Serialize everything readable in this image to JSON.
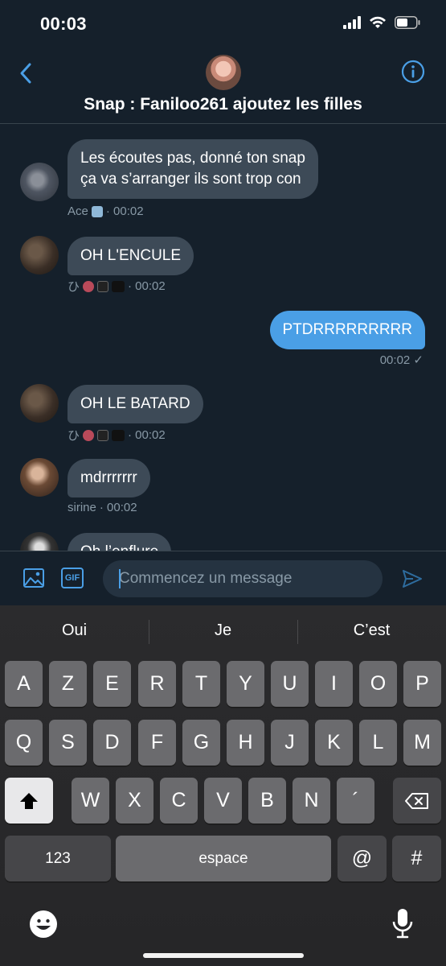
{
  "status": {
    "time": "00:03"
  },
  "header": {
    "title": "Snap : Faniloo261 ajoutez les filles"
  },
  "messages": [
    {
      "dir": "in",
      "line1": "Les écoutes pas, donné ton snap",
      "line2": "ça va s’arranger ils sont trop con",
      "sender": "Ace",
      "time": "· 00:02"
    },
    {
      "dir": "in",
      "text": "OH L'ENCULE",
      "sender": "ひ",
      "time": "· 00:02"
    },
    {
      "dir": "out",
      "text": "PTDRRRRRRRRR",
      "time": "00:02 ✓"
    },
    {
      "dir": "in",
      "text": "OH LE BATARD",
      "sender": "ひ",
      "time": "· 00:02"
    },
    {
      "dir": "in",
      "text": "mdrrrrrrr",
      "sender": "sirine",
      "time": "· 00:02"
    },
    {
      "dir": "in",
      "text": "Oh l’enflure"
    }
  ],
  "composer": {
    "placeholder": "Commencez un message",
    "gif_label": "GIF"
  },
  "keyboard": {
    "suggestions": [
      "Oui",
      "Je",
      "C’est"
    ],
    "row1": [
      "A",
      "Z",
      "E",
      "R",
      "T",
      "Y",
      "U",
      "I",
      "O",
      "P"
    ],
    "row2": [
      "Q",
      "S",
      "D",
      "F",
      "G",
      "H",
      "J",
      "K",
      "L",
      "M"
    ],
    "row3": [
      "W",
      "X",
      "C",
      "V",
      "B",
      "N",
      "´"
    ],
    "numbers_label": "123",
    "space_label": "espace",
    "at_label": "@",
    "hash_label": "#"
  },
  "colors": {
    "background": "#15202b",
    "accent": "#4a9fe6",
    "bubble_in": "#3d4a57"
  }
}
